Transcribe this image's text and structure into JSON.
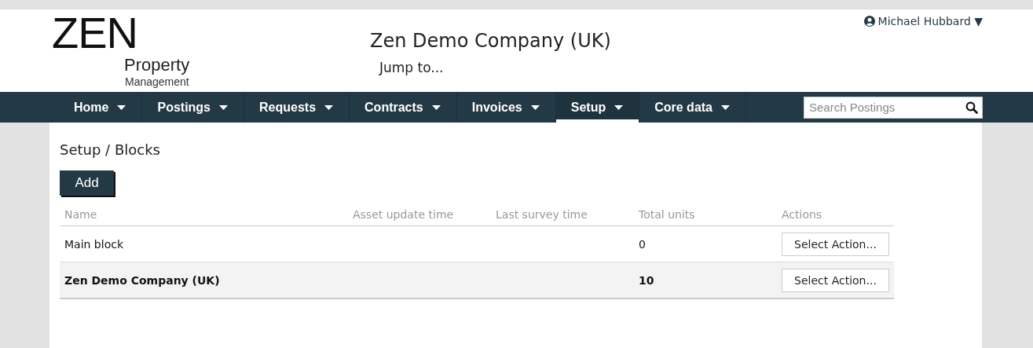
{
  "logo": {
    "word": "ZEN",
    "line_1": "Property",
    "line_2": "Management"
  },
  "company": "Zen Demo Company (UK)",
  "jump_to": "Jump to...",
  "user": {
    "name": "Michael Hubbard",
    "caret": "▼"
  },
  "nav": [
    {
      "label": "Home",
      "selected": false
    },
    {
      "label": "Postings",
      "selected": false
    },
    {
      "label": "Requests",
      "selected": false
    },
    {
      "label": "Contracts",
      "selected": false
    },
    {
      "label": "Invoices",
      "selected": false
    },
    {
      "label": "Setup",
      "selected": true
    },
    {
      "label": "Core data",
      "selected": false
    }
  ],
  "search": {
    "placeholder": "Search Postings"
  },
  "breadcrumb": "Setup / Blocks",
  "add_button": "Add",
  "table": {
    "columns": [
      "Name",
      "Asset update time",
      "Last survey time",
      "Total units",
      "Actions"
    ],
    "rows": [
      {
        "name": "Main block",
        "total_units": "0",
        "action": "Select Action...",
        "highlighted": false
      },
      {
        "name": "Zen Demo Company (UK)",
        "total_units": "10",
        "action": "Select Action...",
        "highlighted": true
      }
    ]
  }
}
